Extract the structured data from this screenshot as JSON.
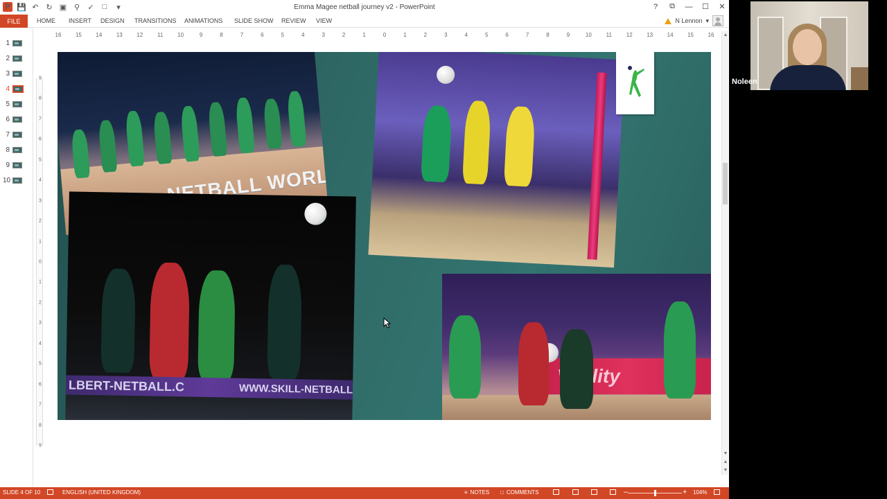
{
  "window": {
    "title": "Emma Magee netball journey v2 - PowerPoint",
    "controls": [
      "?",
      "⧉",
      "—",
      "☐",
      "✕"
    ]
  },
  "ribbon": {
    "file_label": "FILE",
    "tabs": [
      "HOME",
      "INSERT",
      "DESIGN",
      "TRANSITIONS",
      "ANIMATIONS",
      "SLIDE SHOW",
      "REVIEW",
      "VIEW"
    ],
    "user_name": "N Lennon"
  },
  "thumbnails": {
    "numbers": [
      "1",
      "2",
      "3",
      "4",
      "5",
      "6",
      "7",
      "8",
      "9",
      "10"
    ],
    "active": "4"
  },
  "ruler": {
    "horizontal": [
      "16",
      "15",
      "14",
      "13",
      "12",
      "11",
      "10",
      "9",
      "8",
      "7",
      "6",
      "5",
      "4",
      "3",
      "2",
      "1",
      "0",
      "1",
      "2",
      "3",
      "4",
      "5",
      "6",
      "7",
      "8",
      "9",
      "10",
      "11",
      "12",
      "13",
      "14",
      "15",
      "16"
    ],
    "vertical": [
      "9",
      "8",
      "7",
      "6",
      "5",
      "4",
      "3",
      "2",
      "1",
      "0",
      "1",
      "2",
      "3",
      "4",
      "5",
      "6",
      "7",
      "8",
      "9"
    ]
  },
  "slide": {
    "photo1_caption": "NETBALL WORLD CU",
    "photo3_banner_left": "LBERT-NETBALL.C",
    "photo3_banner_right": "WWW.SKILL-NETBALL.COM",
    "photo4_board": "Vitality"
  },
  "status": {
    "slide_info": "SLIDE 4 OF 10",
    "language": "ENGLISH (UNITED KINGDOM)",
    "notes": "NOTES",
    "comments": "COMMENTS",
    "zoom": "104%"
  },
  "webcam": {
    "participant": "Noleen"
  },
  "colors": {
    "accent": "#d24726",
    "slide_bg": "#2f6965"
  }
}
